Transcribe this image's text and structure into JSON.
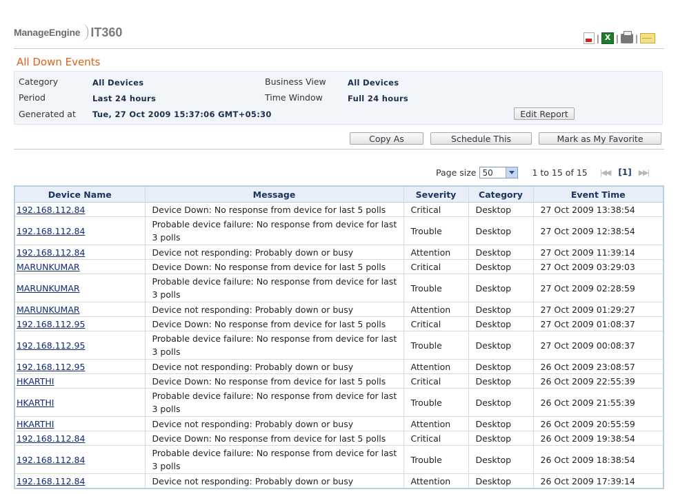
{
  "brand": {
    "logo_text": "ManageEngine",
    "product": "IT360"
  },
  "actions": [
    {
      "name": "pdf-export-icon",
      "icon": "pdf-icon"
    },
    {
      "name": "excel-export-icon",
      "icon": "excel-icon"
    },
    {
      "name": "print-icon",
      "icon": "printer-icon"
    },
    {
      "name": "email-icon",
      "icon": "envelope-icon"
    }
  ],
  "page_title": "All Down Events",
  "info": {
    "category_label": "Category",
    "category_value": "All Devices",
    "business_view_label": "Business View",
    "business_view_value": "All Devices",
    "period_label": "Period",
    "period_value": "Last 24 hours",
    "time_window_label": "Time Window",
    "time_window_value": "Full 24 hours",
    "generated_label": "Generated at",
    "generated_value": "Tue, 27 Oct 2009 15:37:06 GMT+05:30",
    "edit_report_label": "Edit Report"
  },
  "toolbar": {
    "copy_as": "Copy As",
    "schedule": "Schedule This",
    "favorite": "Mark as My Favorite"
  },
  "pager": {
    "page_size_label": "Page size",
    "page_size_value": "50",
    "range": "1 to 15 of 15",
    "current_page": "[1]"
  },
  "table": {
    "columns": [
      "Device Name",
      "Message",
      "Severity",
      "Category",
      "Event Time"
    ],
    "rows": [
      [
        "192.168.112.84",
        "Device Down: No response from device for last 5 polls",
        "Critical",
        "Desktop",
        "27 Oct 2009 13:38:54"
      ],
      [
        "192.168.112.84",
        "Probable device failure: No response from device for last 3 polls",
        "Trouble",
        "Desktop",
        "27 Oct 2009 12:38:54"
      ],
      [
        "192.168.112.84",
        "Device not responding: Probably down or busy",
        "Attention",
        "Desktop",
        "27 Oct 2009 11:39:14"
      ],
      [
        "MARUNKUMAR",
        "Device Down: No response from device for last 5 polls",
        "Critical",
        "Desktop",
        "27 Oct 2009 03:29:03"
      ],
      [
        "MARUNKUMAR",
        "Probable device failure: No response from device for last 3 polls",
        "Trouble",
        "Desktop",
        "27 Oct 2009 02:28:59"
      ],
      [
        "MARUNKUMAR",
        "Device not responding: Probably down or busy",
        "Attention",
        "Desktop",
        "27 Oct 2009 01:29:27"
      ],
      [
        "192.168.112.95",
        "Device Down: No response from device for last 5 polls",
        "Critical",
        "Desktop",
        "27 Oct 2009 01:08:37"
      ],
      [
        "192.168.112.95",
        "Probable device failure: No response from device for last 3 polls",
        "Trouble",
        "Desktop",
        "27 Oct 2009 00:08:37"
      ],
      [
        "192.168.112.95",
        "Device not responding: Probably down or busy",
        "Attention",
        "Desktop",
        "26 Oct 2009 23:08:57"
      ],
      [
        "HKARTHI",
        "Device Down: No response from device for last 5 polls",
        "Critical",
        "Desktop",
        "26 Oct 2009 22:55:39"
      ],
      [
        "HKARTHI",
        "Probable device failure: No response from device for last 3 polls",
        "Trouble",
        "Desktop",
        "26 Oct 2009 21:55:39"
      ],
      [
        "HKARTHI",
        "Device not responding: Probably down or busy",
        "Attention",
        "Desktop",
        "26 Oct 2009 20:55:59"
      ],
      [
        "192.168.112.84",
        "Device Down: No response from device for last 5 polls",
        "Critical",
        "Desktop",
        "26 Oct 2009 19:38:54"
      ],
      [
        "192.168.112.84",
        "Probable device failure: No response from device for last 3 polls",
        "Trouble",
        "Desktop",
        "26 Oct 2009 18:38:54"
      ],
      [
        "192.168.112.84",
        "Device not responding: Probably down or busy",
        "Attention",
        "Desktop",
        "26 Oct 2009 17:39:14"
      ]
    ]
  }
}
